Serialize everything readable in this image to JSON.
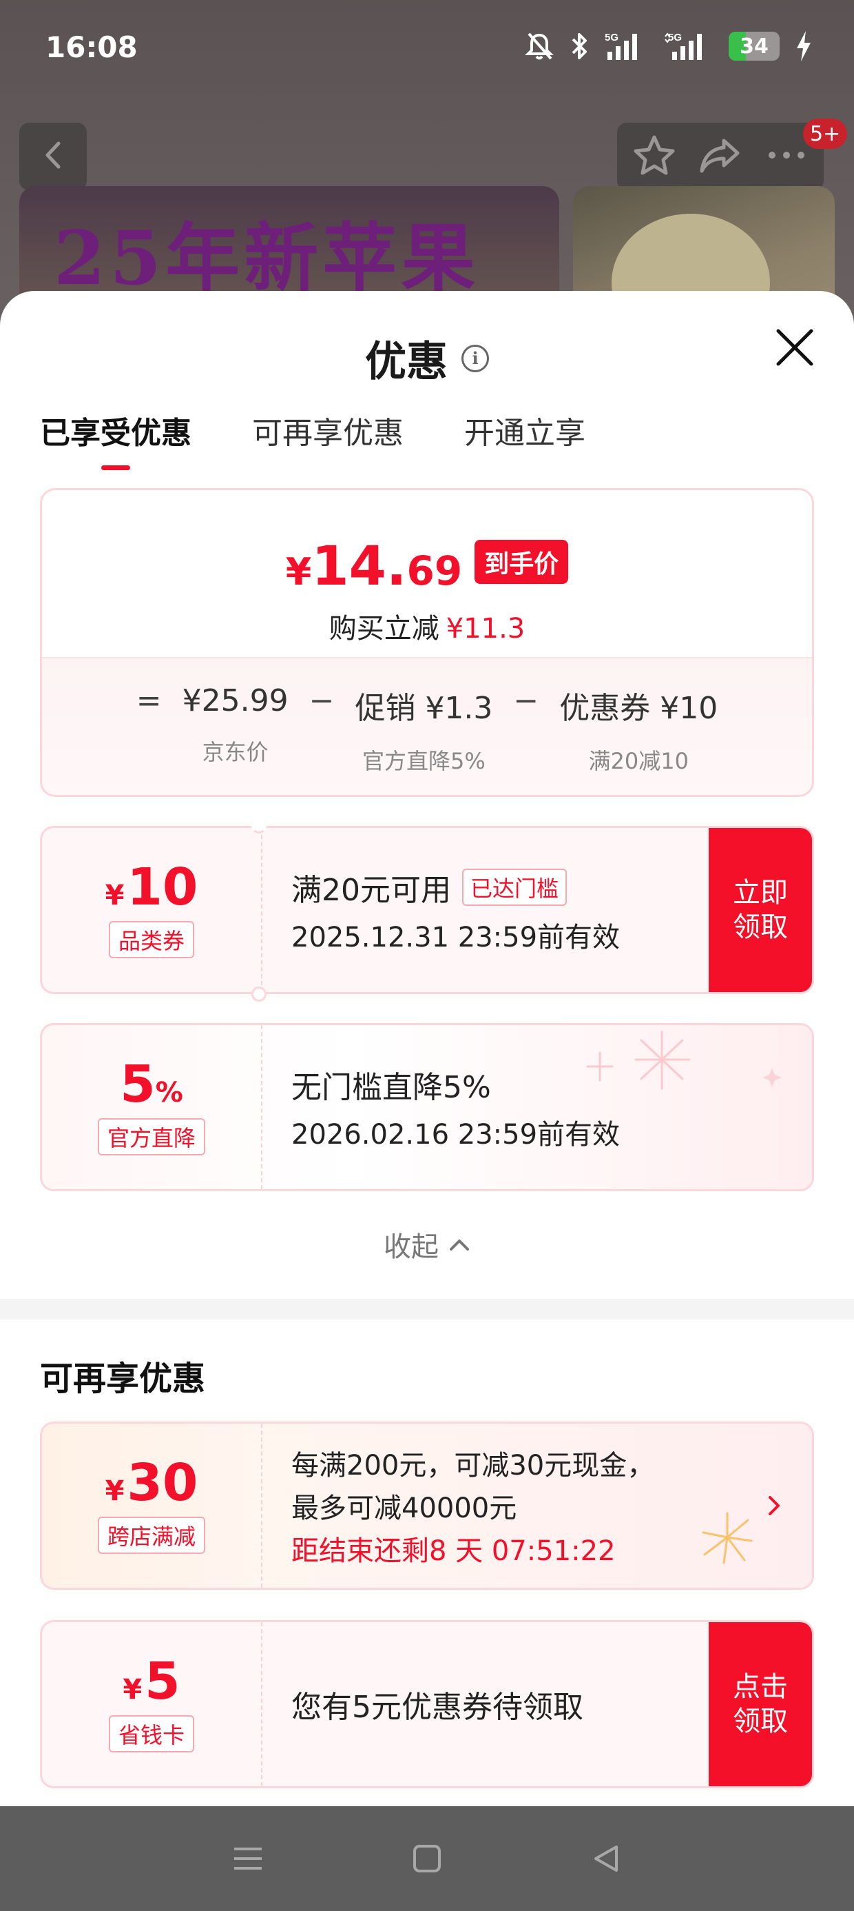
{
  "status_bar": {
    "time": "16:08",
    "network1": "5G",
    "network2": "5G",
    "battery_level": "34",
    "battery_fraction": 0.34
  },
  "product_nav": {
    "badge": "5+",
    "banner_text": "25年新苹果"
  },
  "sheet": {
    "title": "优惠",
    "tabs": [
      {
        "label": "已享受优惠",
        "active": true
      },
      {
        "label": "可再享优惠",
        "active": false
      },
      {
        "label": "开通立享",
        "active": false
      }
    ],
    "summary": {
      "currency": "¥",
      "price_int": "14.",
      "price_dec": "69",
      "price_tag": "到手价",
      "saving_label": "购买立减",
      "saving_value": "¥11.3",
      "eq": "=",
      "minus": "−",
      "items": [
        {
          "value": "¥25.99",
          "sub": "京东价"
        },
        {
          "value": "促销 ¥1.3",
          "sub": "官方直降5%"
        },
        {
          "value": "优惠券 ¥10",
          "sub": "满20减10"
        }
      ]
    },
    "coupons_enjoyed": [
      {
        "symbol": "¥",
        "amount": "10",
        "tag": "品类券",
        "line1": "满20元可用",
        "chip": "已达门槛",
        "line2": "2025.12.31 23:59前有效",
        "button": "立即\n领取"
      },
      {
        "amount": "5",
        "suffix": "%",
        "tag": "官方直降",
        "line1": "无门槛直降5%",
        "line2": "2026.02.16 23:59前有效"
      }
    ],
    "collapse_label": "收起",
    "more_section_title": "可再享优惠",
    "coupons_more": [
      {
        "symbol": "¥",
        "amount": "30",
        "tag": "跨店满减",
        "line1": "每满200元，可减30元现金，",
        "line2": "最多可减40000元",
        "line3": "距结束还剩8 天 07:51:22"
      },
      {
        "symbol": "¥",
        "amount": "5",
        "tag": "省钱卡",
        "line1": "您有5元优惠券待领取",
        "button": "点击\n领取"
      }
    ]
  },
  "colors": {
    "accent": "#f2102a",
    "card_border": "#fbd6da",
    "card_bg": "#fff7f7"
  },
  "icons": [
    "back-icon",
    "star-icon",
    "share-icon",
    "more-icon",
    "info-icon",
    "close-icon",
    "chevron-up-icon",
    "chevron-right-icon",
    "menu-icon",
    "home-icon",
    "back-triangle-icon"
  ]
}
